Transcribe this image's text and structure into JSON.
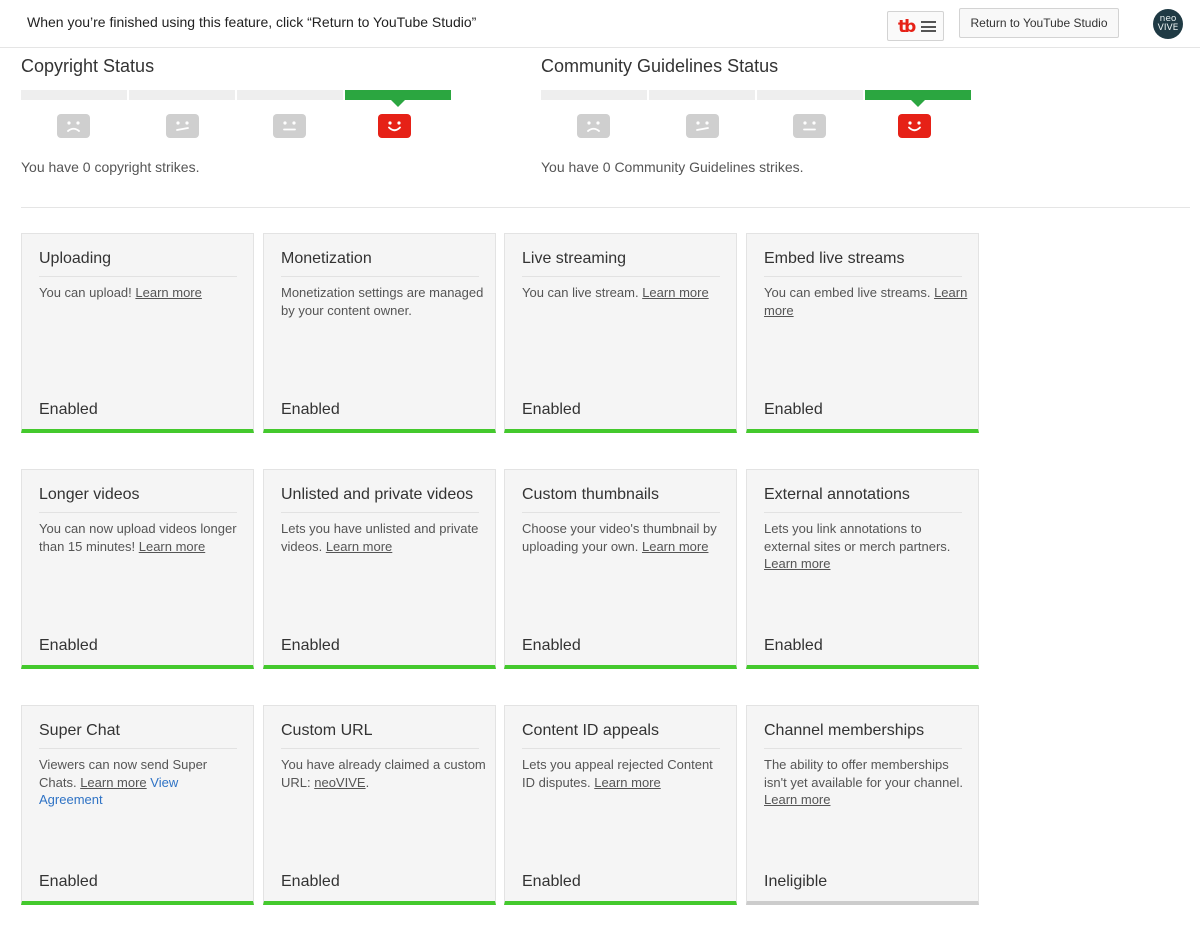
{
  "topbar": {
    "message": "When you’re finished using this feature, click “Return to YouTube Studio”",
    "tubebuddy_logo": "tb",
    "return_button": "Return to YouTube Studio",
    "avatar_text": "neo VIVE"
  },
  "copyright": {
    "title": "Copyright Status",
    "text": "You have 0 copyright strikes.",
    "active_level": 4
  },
  "community": {
    "title": "Community Guidelines Status",
    "text": "You have 0 Community Guidelines strikes.",
    "active_level": 4
  },
  "icons": {
    "strike_faces": [
      "frown-face-icon",
      "unsure-face-icon",
      "neutral-face-icon",
      "happy-face-icon"
    ]
  },
  "colors": {
    "enabled_bar": "#44c92d",
    "ineligible_bar": "#cccccc",
    "active_segment": "#2ba640",
    "active_face": "#e62117",
    "inactive_face": "#cfcfcf",
    "view_agreement_link": "#2f73c5"
  },
  "cards": [
    {
      "title": "Uploading",
      "desc_text": "You can upload! ",
      "link": "Learn more",
      "status": "Enabled"
    },
    {
      "title": "Monetization",
      "desc_text": "Monetization settings are managed by your content owner.",
      "status": "Enabled"
    },
    {
      "title": "Live streaming",
      "desc_text": "You can live stream. ",
      "link": "Learn more",
      "status": "Enabled"
    },
    {
      "title": "Embed live streams",
      "desc_text": "You can embed live streams. ",
      "link": "Learn more",
      "status": "Enabled"
    },
    {
      "title": "Longer videos",
      "desc_text": "You can now upload videos longer than 15 minutes! ",
      "link": "Learn more",
      "status": "Enabled"
    },
    {
      "title": "Unlisted and private videos",
      "desc_text": "Lets you have unlisted and private videos. ",
      "link": "Learn more",
      "status": "Enabled"
    },
    {
      "title": "Custom thumbnails",
      "desc_text": "Choose your video's thumbnail by uploading your own. ",
      "link": "Learn more",
      "status": "Enabled"
    },
    {
      "title": "External annotations",
      "desc_text": "Lets you link annotations to external sites or merch partners. ",
      "link": "Learn more",
      "status": "Enabled"
    },
    {
      "title": "Super Chat",
      "desc_text": "Viewers can now send Super Chats. ",
      "link": "Learn more",
      "link2": "View Agreement",
      "status": "Enabled"
    },
    {
      "title": "Custom URL",
      "desc_text": "You have already claimed a custom URL: ",
      "link": "neoVIVE",
      "desc_after": ".",
      "status": "Enabled"
    },
    {
      "title": "Content ID appeals",
      "desc_text": "Lets you appeal rejected Content ID disputes. ",
      "link": "Learn more",
      "status": "Enabled"
    },
    {
      "title": "Channel memberships",
      "desc_text": "The ability to offer memberships isn't yet available for your channel. ",
      "link": "Learn more",
      "status": "Ineligible"
    }
  ]
}
